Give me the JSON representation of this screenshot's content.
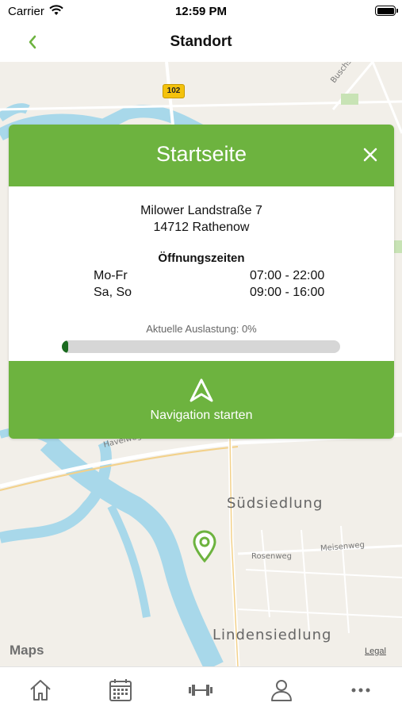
{
  "status_bar": {
    "carrier": "Carrier",
    "time": "12:59 PM"
  },
  "nav": {
    "title": "Standort",
    "back_icon": "chevron-left-icon"
  },
  "map": {
    "labels": {
      "suedsiedlung": "Südsiedlung",
      "lindensiedlung": "Lindensiedlung",
      "rosenweg": "Rosenweg",
      "meisenweg": "Meisenweg",
      "havelweg": "Havelweg",
      "buschstrasse": "Buschstraße"
    },
    "road_badge": "102",
    "attribution": "Maps",
    "legal": "Legal"
  },
  "card": {
    "title": "Startseite",
    "address_line1": "Milower Landstraße 7",
    "address_line2": "14712 Rathenow",
    "hours_title": "Öffnungszeiten",
    "hours": [
      {
        "day": "Mo-Fr",
        "time": "07:00 - 22:00"
      },
      {
        "day": "Sa, So",
        "time": "09:00 - 16:00"
      }
    ],
    "load_label": "Aktuelle Auslastung: 0%",
    "load_percent": 0,
    "nav_button_label": "Navigation starten"
  },
  "tabs": [
    {
      "icon": "home-icon"
    },
    {
      "icon": "calendar-icon"
    },
    {
      "icon": "dumbbell-icon"
    },
    {
      "icon": "person-icon"
    },
    {
      "icon": "more-icon"
    }
  ],
  "colors": {
    "accent": "#6db33f",
    "progress": "#1a6a1f",
    "water": "#a8d8ea",
    "map_bg": "#f2efe9"
  }
}
